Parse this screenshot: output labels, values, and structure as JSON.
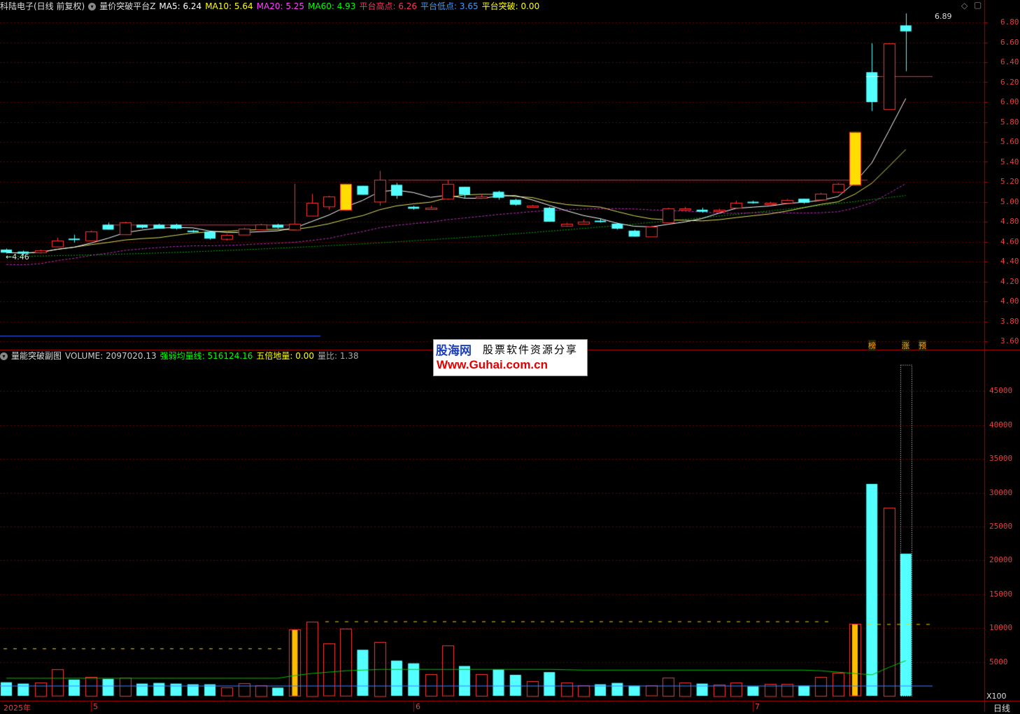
{
  "main_header": {
    "stock": "科陆电子(日线 前复权)",
    "indicator": "量价突破平台Z",
    "items": [
      {
        "label": "MA5: 6.24",
        "color": "#ffffff"
      },
      {
        "label": "MA10: 5.64",
        "color": "#ffff00"
      },
      {
        "label": "MA20: 5.25",
        "color": "#ff40ff"
      },
      {
        "label": "MA60: 4.93",
        "color": "#00ff00"
      },
      {
        "label": "平台高点: 6.26",
        "color": "#ff3060"
      },
      {
        "label": "平台低点: 3.65",
        "color": "#3d9bff"
      },
      {
        "label": "平台突破: 0.00",
        "color": "#ffff00"
      }
    ]
  },
  "sub_header": {
    "indicator": "量能突破副图",
    "items": [
      {
        "label": "VOLUME: 2097020.13",
        "color": "#cccccc"
      },
      {
        "label": "强弱均量线: 516124.16",
        "color": "#00ff00"
      },
      {
        "label": "五倍地量: 0.00",
        "color": "#ffff00"
      },
      {
        "label": "量比: 1.38",
        "color": "#aaaaaa"
      }
    ]
  },
  "price_axis": [
    "6.80",
    "6.60",
    "6.40",
    "6.20",
    "6.00",
    "5.80",
    "5.60",
    "5.40",
    "5.20",
    "5.00",
    "4.80",
    "4.60",
    "4.40",
    "4.20",
    "4.00",
    "3.80",
    "3.60"
  ],
  "volume_axis": [
    "45000",
    "40000",
    "35000",
    "30000",
    "25000",
    "20000",
    "15000",
    "10000",
    "5000"
  ],
  "volume_unit": "X100",
  "x_labels": [
    "2025年",
    "5",
    "6",
    "7"
  ],
  "period": "日线",
  "markers": [
    "榜",
    "涨",
    "预"
  ],
  "high_label": "6.89",
  "low_label": "4.46",
  "watermark": {
    "line1": "股海网",
    "line1b": "股票软件资源分享",
    "line2": "Www.Guhai.com.cn"
  },
  "chart_data": {
    "type": "candlestick",
    "candles": [
      [
        4.52,
        4.49,
        4.53,
        4.48,
        "-"
      ],
      [
        4.5,
        4.48,
        4.51,
        4.46,
        "-"
      ],
      [
        4.49,
        4.51,
        4.52,
        4.48,
        "+"
      ],
      [
        4.55,
        4.61,
        4.64,
        4.55,
        "+"
      ],
      [
        4.63,
        4.63,
        4.67,
        4.59,
        "-"
      ],
      [
        4.61,
        4.7,
        4.71,
        4.61,
        "+"
      ],
      [
        4.77,
        4.72,
        4.79,
        4.72,
        "-"
      ],
      [
        4.67,
        4.79,
        4.8,
        4.67,
        "+"
      ],
      [
        4.77,
        4.74,
        4.77,
        4.73,
        "-"
      ],
      [
        4.77,
        4.73,
        4.78,
        4.73,
        "-"
      ],
      [
        4.77,
        4.73,
        4.78,
        4.72,
        "-"
      ],
      [
        4.71,
        4.7,
        4.72,
        4.69,
        "-"
      ],
      [
        4.7,
        4.63,
        4.71,
        4.62,
        "-"
      ],
      [
        4.63,
        4.67,
        4.68,
        4.61,
        "+"
      ],
      [
        4.67,
        4.73,
        4.74,
        4.67,
        "+"
      ],
      [
        4.72,
        4.77,
        4.78,
        4.72,
        "+"
      ],
      [
        4.77,
        4.74,
        4.78,
        4.73,
        "-"
      ],
      [
        4.72,
        4.78,
        5.18,
        4.72,
        "+"
      ],
      [
        4.86,
        4.99,
        5.08,
        4.86,
        "+"
      ],
      [
        4.95,
        5.05,
        5.06,
        4.92,
        "+"
      ],
      [
        4.92,
        5.18,
        5.18,
        4.92,
        "Y"
      ],
      [
        5.16,
        5.07,
        5.16,
        5.07,
        "-"
      ],
      [
        5.0,
        5.22,
        5.31,
        4.96,
        "+"
      ],
      [
        5.17,
        5.06,
        5.19,
        5.03,
        "-"
      ],
      [
        4.95,
        4.93,
        4.96,
        4.92,
        "-"
      ],
      [
        4.93,
        4.94,
        4.96,
        4.92,
        "+"
      ],
      [
        5.03,
        5.18,
        5.22,
        5.02,
        "+"
      ],
      [
        5.15,
        5.07,
        5.15,
        5.04,
        "-"
      ],
      [
        5.05,
        5.05,
        5.08,
        5.03,
        "+"
      ],
      [
        5.1,
        5.04,
        5.11,
        5.02,
        "-"
      ],
      [
        5.02,
        4.97,
        5.03,
        4.96,
        "-"
      ],
      [
        4.96,
        4.96,
        4.97,
        4.95,
        "+"
      ],
      [
        4.94,
        4.8,
        4.95,
        4.8,
        "-"
      ],
      [
        4.76,
        4.78,
        4.79,
        4.75,
        "+"
      ],
      [
        4.78,
        4.8,
        4.82,
        4.78,
        "+"
      ],
      [
        4.8,
        4.81,
        4.83,
        4.79,
        "-"
      ],
      [
        4.78,
        4.73,
        4.79,
        4.72,
        "-"
      ],
      [
        4.71,
        4.65,
        4.72,
        4.65,
        "-"
      ],
      [
        4.65,
        4.75,
        4.76,
        4.65,
        "+"
      ],
      [
        4.79,
        4.93,
        4.94,
        4.79,
        "+"
      ],
      [
        4.92,
        4.93,
        4.95,
        4.91,
        "+"
      ],
      [
        4.92,
        4.9,
        4.94,
        4.89,
        "-"
      ],
      [
        4.91,
        4.92,
        4.93,
        4.9,
        "+"
      ],
      [
        4.94,
        4.99,
        5.01,
        4.94,
        "+"
      ],
      [
        5.0,
        4.99,
        5.01,
        4.98,
        "-"
      ],
      [
        4.98,
        4.99,
        5.0,
        4.97,
        "+"
      ],
      [
        4.99,
        5.02,
        5.03,
        4.99,
        "+"
      ],
      [
        5.03,
        4.99,
        5.03,
        4.98,
        "-"
      ],
      [
        5.02,
        5.08,
        5.09,
        5.02,
        "+"
      ],
      [
        5.1,
        5.18,
        5.19,
        5.09,
        "+"
      ],
      [
        5.17,
        5.7,
        5.7,
        5.17,
        "Y"
      ],
      [
        6.3,
        6.0,
        6.59,
        5.91,
        "-"
      ],
      [
        5.93,
        6.59,
        6.59,
        5.93,
        "+"
      ],
      [
        6.77,
        6.71,
        6.89,
        6.31,
        "-"
      ]
    ],
    "volume": [
      [
        2000,
        "-"
      ],
      [
        1800,
        "-"
      ],
      [
        2000,
        "+"
      ],
      [
        3900,
        "+"
      ],
      [
        2400,
        "-"
      ],
      [
        2800,
        "+"
      ],
      [
        2500,
        "-"
      ],
      [
        2700,
        "+"
      ],
      [
        1800,
        "-"
      ],
      [
        1900,
        "-"
      ],
      [
        1800,
        "-"
      ],
      [
        1700,
        "-"
      ],
      [
        1700,
        "-"
      ],
      [
        1200,
        "+"
      ],
      [
        1900,
        "+"
      ],
      [
        1600,
        "+"
      ],
      [
        1200,
        "-"
      ],
      [
        9800,
        "Y"
      ],
      [
        11000,
        "+"
      ],
      [
        7700,
        "+"
      ],
      [
        9900,
        "+"
      ],
      [
        6800,
        "-"
      ],
      [
        8000,
        "+"
      ],
      [
        5200,
        "-"
      ],
      [
        4800,
        "-"
      ],
      [
        3200,
        "+"
      ],
      [
        7400,
        "+"
      ],
      [
        4400,
        "-"
      ],
      [
        3200,
        "+"
      ],
      [
        3900,
        "-"
      ],
      [
        3100,
        "-"
      ],
      [
        2200,
        "+"
      ],
      [
        3500,
        "-"
      ],
      [
        2000,
        "+"
      ],
      [
        1600,
        "+"
      ],
      [
        1700,
        "-"
      ],
      [
        1900,
        "-"
      ],
      [
        1500,
        "-"
      ],
      [
        1500,
        "+"
      ],
      [
        2700,
        "+"
      ],
      [
        2000,
        "+"
      ],
      [
        1800,
        "-"
      ],
      [
        1700,
        "+"
      ],
      [
        2000,
        "+"
      ],
      [
        1400,
        "-"
      ],
      [
        1800,
        "+"
      ],
      [
        1800,
        "+"
      ],
      [
        1500,
        "-"
      ],
      [
        2800,
        "+"
      ],
      [
        3400,
        "+"
      ],
      [
        10600,
        "Y"
      ],
      [
        31300,
        "-"
      ],
      [
        27800,
        "+"
      ],
      [
        21000,
        "-"
      ]
    ],
    "volume_forecast": 48900,
    "platform_high": 5.22,
    "ytick_labels": "see price_axis"
  }
}
